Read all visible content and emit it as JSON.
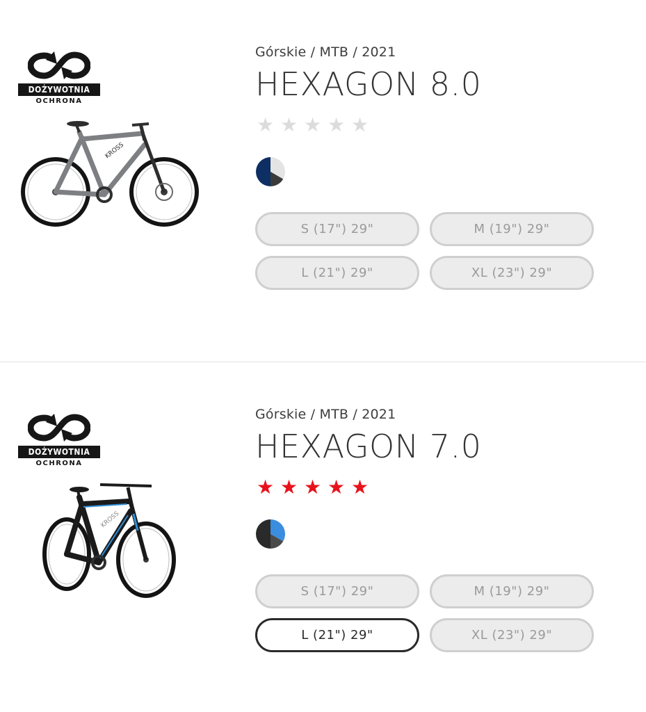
{
  "products": [
    {
      "badge_line1": "DOŻYWOTNIA",
      "badge_line2": "OCHRONA",
      "badge_icon": "infinity-icon",
      "breadcrumb": "Górskie / MTB / 2021",
      "title": "HEXAGON 8.0",
      "rating": 0,
      "star_color_filled": "#e8121c",
      "star_color_empty": "#dcdcdc",
      "color_swatch": [
        "#0d2f63",
        "#e4e4e4",
        "#3a3a3a"
      ],
      "bike_colors": {
        "frame": "#7d7f82",
        "accent": "#3a3a3a"
      },
      "sizes": [
        {
          "label": "S (17\") 29\"",
          "state": "unavailable"
        },
        {
          "label": "M (19\") 29\"",
          "state": "unavailable"
        },
        {
          "label": "L (21\") 29\"",
          "state": "unavailable"
        },
        {
          "label": "XL (23\") 29\"",
          "state": "unavailable"
        }
      ]
    },
    {
      "badge_line1": "DOŻYWOTNIA",
      "badge_line2": "OCHRONA",
      "badge_icon": "infinity-icon",
      "breadcrumb": "Górskie / MTB / 2021",
      "title": "HEXAGON 7.0",
      "rating": 5,
      "star_color_filled": "#e8121c",
      "star_color_empty": "#dcdcdc",
      "color_swatch": [
        "#2a2a2a",
        "#3b8de0",
        "#4a4a4a"
      ],
      "bike_colors": {
        "frame": "#1b1b1b",
        "accent": "#2f8fd8"
      },
      "sizes": [
        {
          "label": "S (17\") 29\"",
          "state": "unavailable"
        },
        {
          "label": "M (19\") 29\"",
          "state": "unavailable"
        },
        {
          "label": "L (21\") 29\"",
          "state": "available"
        },
        {
          "label": "XL (23\") 29\"",
          "state": "unavailable"
        }
      ]
    }
  ]
}
